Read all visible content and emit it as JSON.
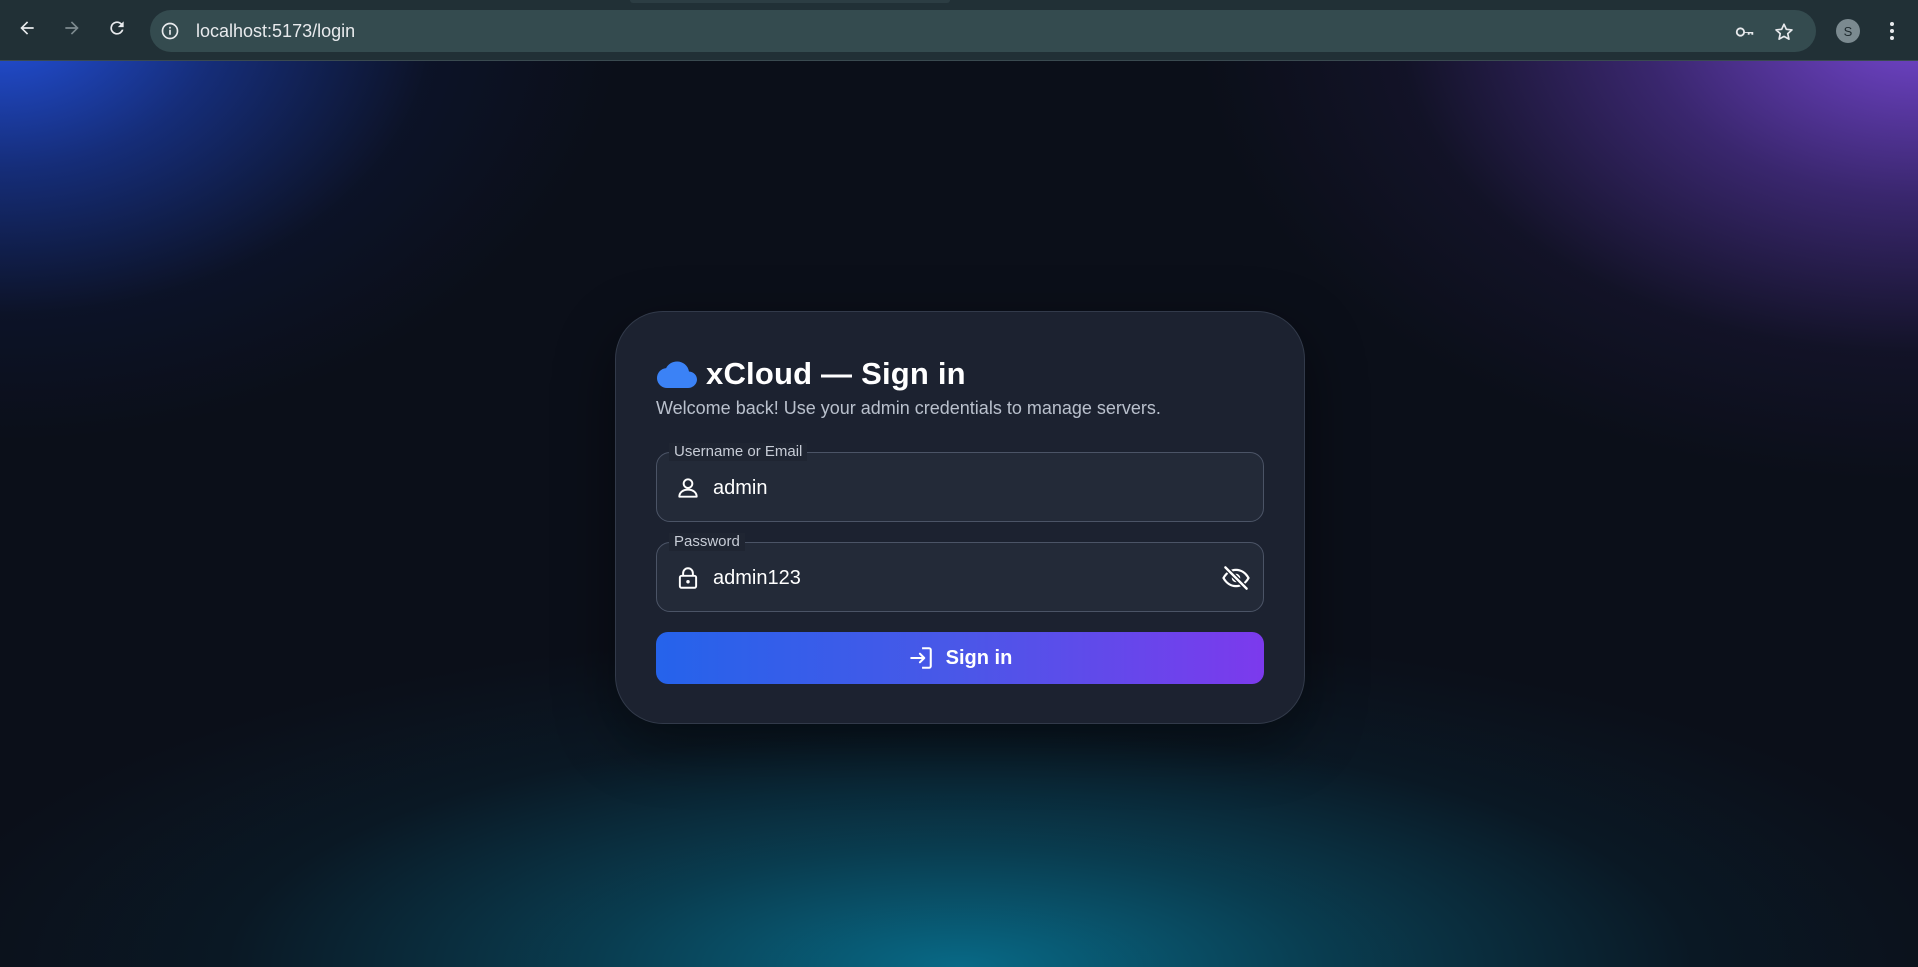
{
  "browser": {
    "url": "localhost:5173/login",
    "profile_initial": "S"
  },
  "login": {
    "title": "xCloud — Sign in",
    "subtitle": "Welcome back! Use your admin credentials to manage servers.",
    "username": {
      "label": "Username or Email",
      "value": "admin"
    },
    "password": {
      "label": "Password",
      "value": "admin123"
    },
    "submit_label": "Sign in"
  },
  "colors": {
    "brand_blue": "#2563eb",
    "brand_purple": "#7c3aed",
    "card_bg": "#1c2230",
    "page_bg": "#0b0f19"
  },
  "icons": {
    "back": "arrow-left-icon",
    "forward": "arrow-right-icon",
    "reload": "reload-icon",
    "site_info": "info-icon",
    "password_manager": "key-icon",
    "bookmark": "star-icon",
    "menu": "kebab-menu-icon",
    "brand": "cloud-icon",
    "user": "person-icon",
    "lock": "lock-icon",
    "visibility": "eye-off-icon",
    "login": "login-icon"
  }
}
